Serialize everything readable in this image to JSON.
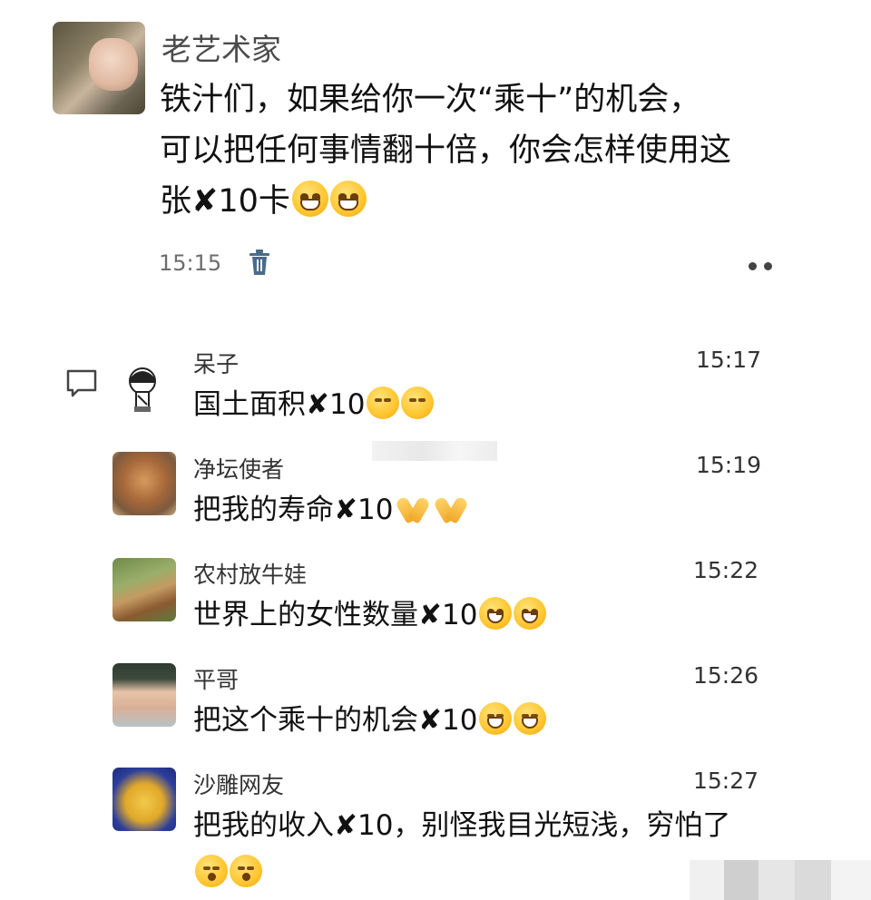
{
  "post": {
    "author": "老艺术家",
    "text_line1": "铁汁们，如果给你一次“乘十”的机会，",
    "text_line2": "可以把任何事情翻十倍，你会怎样使用这",
    "text_line3_prefix": "张",
    "text_line3_mark": "✘",
    "text_line3_suffix": "10卡",
    "time": "15:15",
    "emoji": "smirk-emoji"
  },
  "comments": [
    {
      "author": "呆子",
      "time": "15:17",
      "text_prefix": "国土面积",
      "mark": "✘",
      "text_suffix": "10",
      "emoji": "smirk-emoji"
    },
    {
      "author": "净坛使者",
      "time": "15:19",
      "text_prefix": "把我的寿命",
      "mark": "✘",
      "text_suffix": "10",
      "emoji": "praying-hands-emoji"
    },
    {
      "author": "农村放牛娃",
      "time": "15:22",
      "text_prefix": "世界上的女性数量",
      "mark": "✘",
      "text_suffix": "10",
      "emoji": "grin-emoji"
    },
    {
      "author": "平哥",
      "time": "15:26",
      "text_prefix": "把这个乘十的机会",
      "mark": "✘",
      "text_suffix": "10",
      "emoji": "blush-emoji"
    },
    {
      "author": "沙雕网友",
      "time": "15:27",
      "text_prefix": "把我的收入",
      "mark": "✘",
      "text_suffix": "10，别怪我目光短浅，穷怕了",
      "emoji": "shock-emoji"
    }
  ]
}
